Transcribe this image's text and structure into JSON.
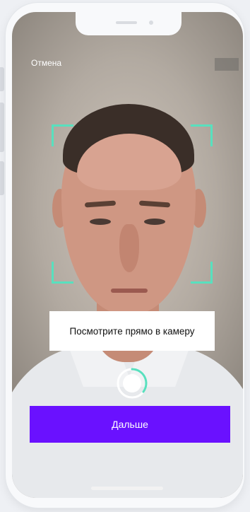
{
  "screen": {
    "cancel_label": "Отмена",
    "hint_text": "Посмотрите прямо в камеру",
    "next_button_label": "Дальше",
    "capture_icon": "shutter-ring-icon",
    "frame_color": "#58e0be",
    "accent_color": "#6a11ff"
  }
}
